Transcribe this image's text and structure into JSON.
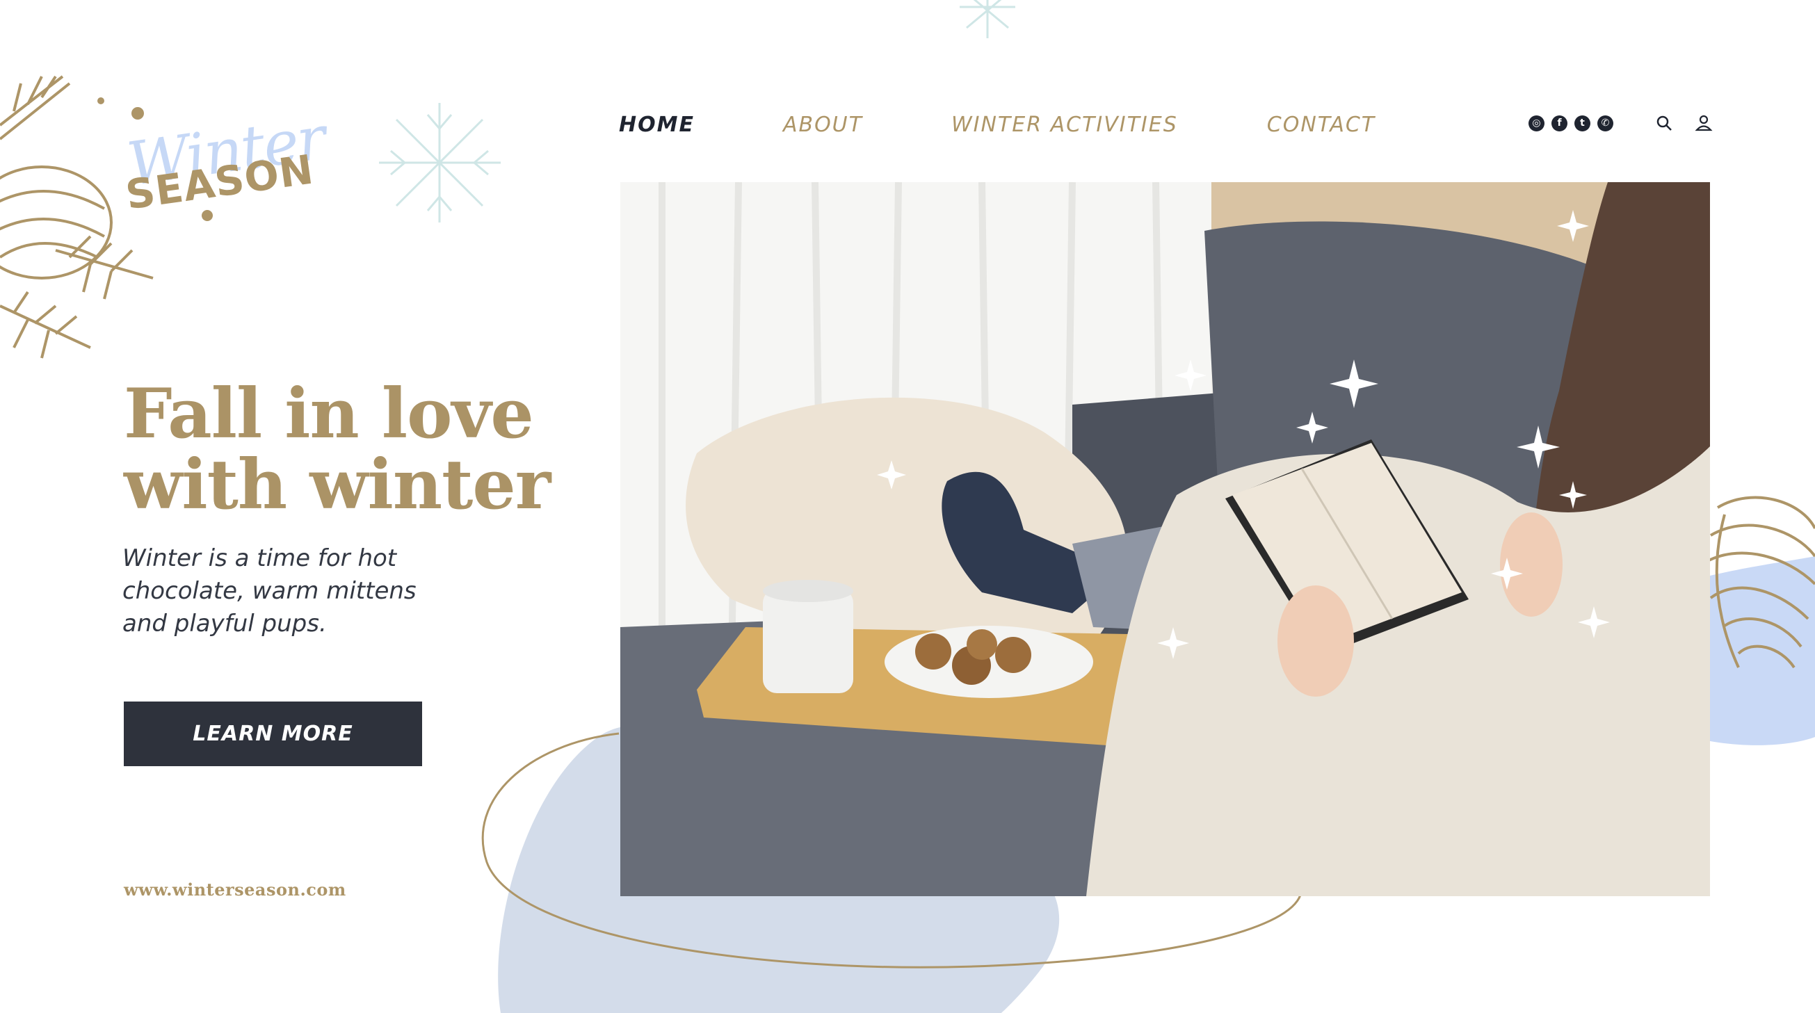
{
  "logo": {
    "line1": "Winter",
    "line2": "SEASON"
  },
  "nav": {
    "items": [
      {
        "label": "HOME",
        "active": true
      },
      {
        "label": "ABOUT",
        "active": false
      },
      {
        "label": "WINTER ACTIVITIES",
        "active": false
      },
      {
        "label": "CONTACT",
        "active": false
      }
    ],
    "social_icons": [
      "instagram-icon",
      "facebook-icon",
      "twitter-icon",
      "whatsapp-icon"
    ],
    "tools": [
      "search-icon",
      "user-icon"
    ]
  },
  "hero": {
    "headline_lines": [
      "Fall in love",
      "with winter"
    ],
    "subcopy_lines": [
      "Winter is a time for hot",
      "chocolate, warm mittens",
      "and playful pups."
    ],
    "cta_label": "LEARN MORE",
    "website": "www.winterseason.com"
  },
  "colors": {
    "gold": "#ad9567",
    "navy": "#2e323c",
    "ice_blue": "#c6d8f6",
    "blob_blue": "#d3dcea",
    "text": "#333843"
  }
}
